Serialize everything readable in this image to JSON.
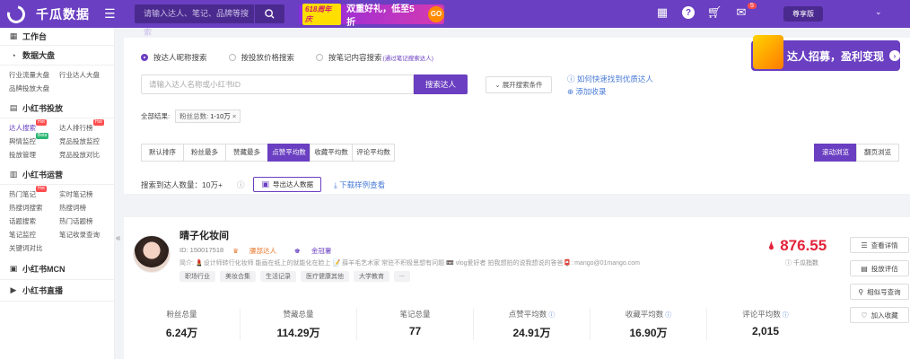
{
  "app": {
    "name": "千瓜数据"
  },
  "search": {
    "placeholder": "请输入达人、笔记、品牌等搜索"
  },
  "promo": {
    "tag": "618周年庆",
    "text": "双重好礼，低至5折",
    "go": "GO"
  },
  "topbar": {
    "notif_count": "5",
    "vip_label": "尊享版"
  },
  "sidebar": {
    "workbench": "工作台",
    "sections": [
      {
        "title": "数据大盘",
        "items": [
          {
            "label": "行业流量大盘"
          },
          {
            "label": "行业达人大盘"
          },
          {
            "label": "品牌投放大盘"
          }
        ]
      },
      {
        "title": "小红书投放",
        "items": [
          {
            "label": "达人搜索",
            "badge": "Hot"
          },
          {
            "label": "达人排行榜",
            "badge": "Hot"
          },
          {
            "label": "舆情监控",
            "badge": "Beta"
          },
          {
            "label": "竞品投放监控"
          },
          {
            "label": "投放管理"
          },
          {
            "label": "竞品投放对比"
          }
        ]
      },
      {
        "title": "小红书运营",
        "items": [
          {
            "label": "热门笔记",
            "badge": "Hot"
          },
          {
            "label": "实时笔记榜"
          },
          {
            "label": "热搜词搜索"
          },
          {
            "label": "热搜词榜"
          },
          {
            "label": "话题搜索"
          },
          {
            "label": "热门话题榜"
          },
          {
            "label": "笔记监控"
          },
          {
            "label": "笔记收录查询"
          },
          {
            "label": "关键词对比"
          }
        ]
      },
      {
        "title": "小红书MCN",
        "items": []
      },
      {
        "title": "小红书直播",
        "items": []
      }
    ]
  },
  "searchPanel": {
    "modes": [
      {
        "label": "按达人昵称搜索",
        "selected": true
      },
      {
        "label": "按投放价格搜索",
        "selected": false
      },
      {
        "label": "按笔记内容搜索",
        "note": "(通过笔记搜索达人)",
        "selected": false
      }
    ],
    "input_placeholder": "请输入达人名称或小红书ID",
    "search_button": "搜索达人",
    "expand_button": "展开搜索条件",
    "help_link": "如何快速找到优质达人",
    "add_favorite": "添加收录",
    "results_label": "全部结果:",
    "filter_chip": {
      "label": "粉丝总数: ",
      "value": "1-10万"
    },
    "sort_tabs": [
      {
        "label": "默认排序",
        "active": false
      },
      {
        "label": "粉丝最多",
        "active": false
      },
      {
        "label": "赞藏最多",
        "active": false
      },
      {
        "label": "点赞平均数",
        "active": true
      },
      {
        "label": "收藏平均数",
        "active": false
      },
      {
        "label": "评论平均数",
        "active": false
      }
    ],
    "view_modes": [
      {
        "label": "滚动浏览",
        "active": true
      },
      {
        "label": "翻页浏览",
        "active": false
      }
    ],
    "result_count_label": "搜索到达人数量：",
    "result_count": "10万+",
    "export_button": "导出达人数据",
    "download_link": "下载样例查看"
  },
  "recruit_banner": {
    "text": "达人招募，盈利变现"
  },
  "kol": {
    "name": "晴子化妆间",
    "id": "ID: 150017518",
    "tier": "腰部达人",
    "crown": "金冠薯",
    "bio": "简介: 💄设计师转行化妆师 能画在纸上的就能化在脸上 📝 薛羊毛艺术家 常驻不积极思想有问题 📼 vlog爱好者 拍我想拍的说我想说的答爸📮: mango@01mango.com",
    "tags": [
      "职场行业",
      "美妆合集",
      "生活记录",
      "医疗健康其他",
      "大学教育",
      "..."
    ],
    "score": "876.55",
    "score_label": "千瓜指数",
    "actions": [
      {
        "label": "查看详情",
        "icon": "list-icon"
      },
      {
        "label": "投放评估",
        "icon": "doc-icon"
      },
      {
        "label": "相似号查询",
        "icon": "search-icon"
      },
      {
        "label": "加入收藏",
        "icon": "heart-icon"
      }
    ],
    "stats": [
      {
        "label": "粉丝总量",
        "value": "6.24万"
      },
      {
        "label": "赞藏总量",
        "value": "114.29万"
      },
      {
        "label": "笔记总量",
        "value": "77"
      },
      {
        "label": "点赞平均数",
        "value": "24.91万",
        "info": true
      },
      {
        "label": "收藏平均数",
        "value": "16.90万",
        "info": true
      },
      {
        "label": "评论平均数",
        "value": "2,015",
        "info": true
      }
    ]
  },
  "colors": {
    "brand": "#6a3fc1",
    "score": "#e2233a",
    "link": "#4a7bd6"
  }
}
